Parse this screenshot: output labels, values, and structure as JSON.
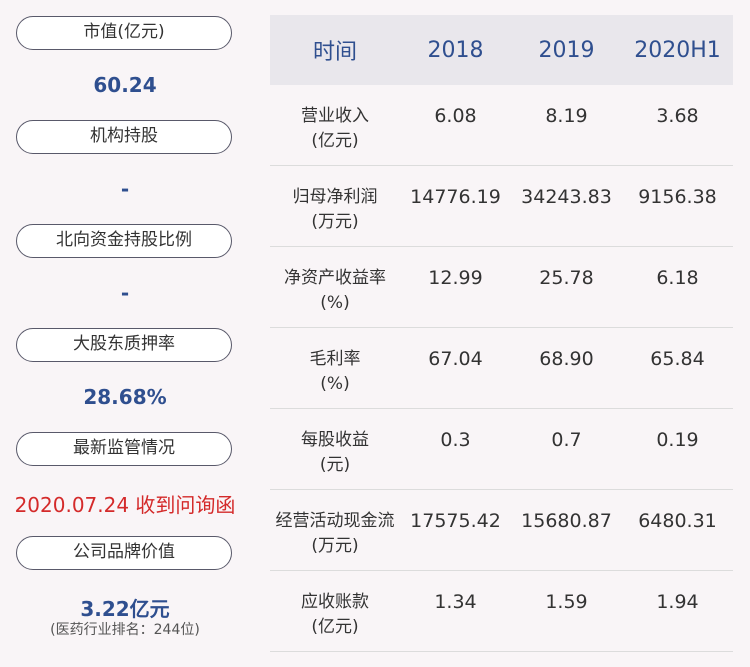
{
  "left": {
    "items": [
      {
        "label": "市值(亿元)",
        "value": "60.24"
      },
      {
        "label": "机构持股",
        "value": "-"
      },
      {
        "label": "北向资金持股比例",
        "value": "-"
      },
      {
        "label": "大股东质押率",
        "value": "28.68%"
      },
      {
        "label": "最新监管情况",
        "value": "2020.07.24 收到问询函"
      },
      {
        "label": "公司品牌价值",
        "value": "3.22亿元",
        "note": "(医药行业排名：244位)"
      }
    ],
    "colors": {
      "value": "#2f4f8f",
      "alert": "#d42a2a"
    }
  },
  "table": {
    "headers": [
      "时间",
      "2018",
      "2019",
      "2020H1"
    ],
    "rows": [
      {
        "name": "营业收入\n(亿元)",
        "values": [
          "6.08",
          "8.19",
          "3.68"
        ]
      },
      {
        "name": "归母净利润\n(万元)",
        "values": [
          "14776.19",
          "34243.83",
          "9156.38"
        ]
      },
      {
        "name": "净资产收益率\n(%)",
        "values": [
          "12.99",
          "25.78",
          "6.18"
        ]
      },
      {
        "name": "毛利率\n(%)",
        "values": [
          "67.04",
          "68.90",
          "65.84"
        ]
      },
      {
        "name": "每股收益\n(元)",
        "values": [
          "0.3",
          "0.7",
          "0.19"
        ]
      },
      {
        "name": "经营活动现金流\n(万元)",
        "values": [
          "17575.42",
          "15680.87",
          "6480.31"
        ]
      },
      {
        "name": "应收账款\n(亿元)",
        "values": [
          "1.34",
          "1.59",
          "1.94"
        ]
      }
    ]
  }
}
